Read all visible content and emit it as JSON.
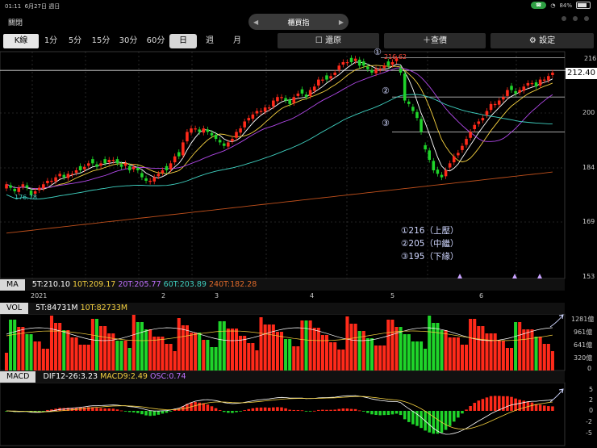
{
  "status": {
    "time": "01:11",
    "date": "6月27日 週日",
    "battery": "84%"
  },
  "header": {
    "close": "關閉",
    "title": "櫃買指"
  },
  "toolbar": {
    "kline": "K線",
    "items": [
      "1分",
      "5分",
      "15分",
      "30分",
      "60分",
      "日",
      "週",
      "月"
    ],
    "selected": "日",
    "restore": "還原",
    "query": "查價",
    "settings": "設定"
  },
  "y_axis": {
    "price": [
      "216",
      "200",
      "184",
      "169",
      "153"
    ],
    "vol": [
      "1281億",
      "961億",
      "641億",
      "320億",
      "0"
    ],
    "macd": [
      "5",
      "2",
      "0",
      "-2",
      "-5"
    ]
  },
  "last_price": "212.40",
  "x_axis": [
    "2021",
    "2",
    "3",
    "4",
    "5",
    "6"
  ],
  "low_label": "176.78",
  "high_label": "216.62",
  "levels": {
    "l1": "①216（上壓）",
    "l2": "②205（中繼）",
    "l3": "③195（下緣）",
    "m1": "①",
    "m2": "②",
    "m3": "③"
  },
  "ma": {
    "tag": "MA",
    "v5": "5T:210.10",
    "v10": "10T:209.17",
    "v20": "20T:205.77",
    "v60": "60T:203.89",
    "v240": "240T:182.28"
  },
  "vol": {
    "tag": "VOL",
    "v5": "5T:84731M",
    "v10": "10T:82733M"
  },
  "macd": {
    "tag": "MACD",
    "dif": "DIF12-26:3.23",
    "macd9": "MACD9:2.49",
    "osc": "OSC:0.74"
  },
  "colors": {
    "up": "#ff2a1a",
    "down": "#1fd42a",
    "ma5": "#ffffff",
    "ma10": "#f4d03f",
    "ma20": "#b048e8",
    "ma60": "#3fd0c0",
    "ma240": "#c0501c"
  },
  "chart_data": {
    "type": "candlestick",
    "closes": [
      180,
      179,
      178,
      179,
      180,
      179,
      177,
      178,
      179,
      180,
      181,
      181,
      182,
      183,
      182,
      183,
      183,
      184,
      184,
      185,
      186,
      186,
      185,
      186,
      186,
      187,
      187,
      186,
      185,
      186,
      184,
      185,
      184,
      182,
      181,
      181,
      182,
      183,
      184,
      184,
      186,
      188,
      188,
      192,
      195,
      196,
      196,
      195,
      196,
      195,
      194,
      193,
      192,
      191,
      192,
      193,
      195,
      196,
      198,
      199,
      200,
      201,
      201,
      202,
      202,
      204,
      205,
      205,
      204,
      203,
      205,
      206,
      206,
      205,
      207,
      208,
      210,
      210,
      210,
      211,
      212,
      214,
      215,
      215,
      215,
      216,
      214,
      214,
      213,
      212,
      213,
      213,
      214,
      214,
      215,
      216,
      212,
      204,
      203,
      201,
      199,
      195,
      190,
      187,
      184,
      183,
      182,
      184,
      186,
      188,
      189,
      191,
      193,
      195,
      197,
      198,
      199,
      201,
      203,
      203,
      204,
      205,
      207,
      207,
      206,
      207,
      208,
      209,
      209,
      208,
      210,
      210,
      211,
      212
    ],
    "y_range": [
      153,
      218
    ],
    "ylim_label": "216"
  }
}
